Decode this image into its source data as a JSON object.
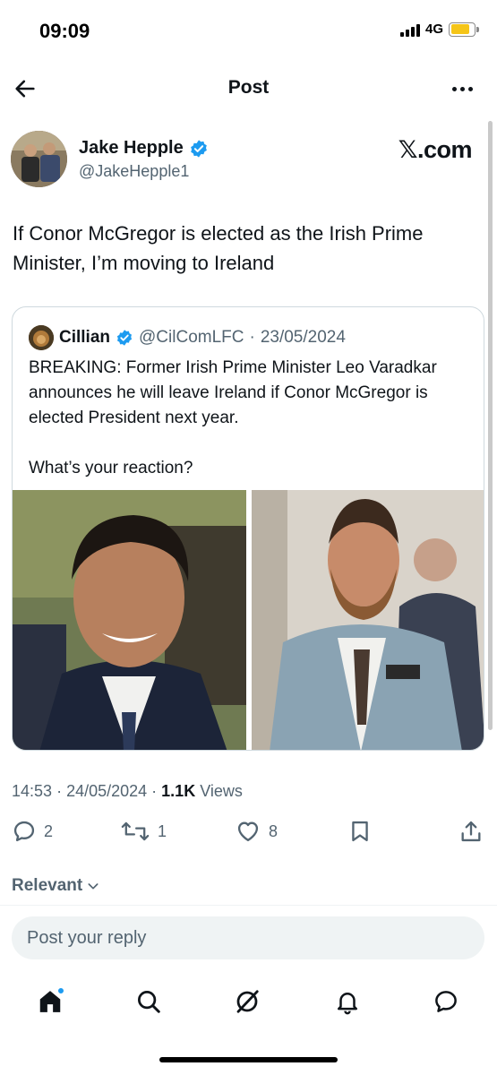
{
  "status_bar": {
    "time": "09:09",
    "network": "4G",
    "battery_color": "#f5c518"
  },
  "header": {
    "title": "Post"
  },
  "author": {
    "name": "Jake Hepple",
    "handle": "@JakeHepple1",
    "verified": true,
    "watermark": "𝕏.com"
  },
  "tweet": {
    "text": "If Conor McGregor is elected as the Irish Prime Minister, I’m moving to Ireland",
    "time": "14:53",
    "date": "24/05/2024",
    "views_count": "1.1K",
    "views_label": "Views"
  },
  "quote": {
    "name": "Cillian",
    "verified": true,
    "handle": "@CilComLFC",
    "date": "23/05/2024",
    "text_1": "BREAKING: Former Irish Prime Minister Leo Varadkar announces he will leave Ireland if Conor McGregor is elected President next year.",
    "text_2": "What’s your reaction?"
  },
  "actions": {
    "replies": "2",
    "reposts": "1",
    "likes": "8"
  },
  "replies_filter": {
    "label": "Relevant"
  },
  "reply_box": {
    "placeholder": "Post your reply"
  },
  "colors": {
    "accent": "#1d9bf0",
    "secondary_text": "#536471",
    "text": "#0f1419"
  }
}
